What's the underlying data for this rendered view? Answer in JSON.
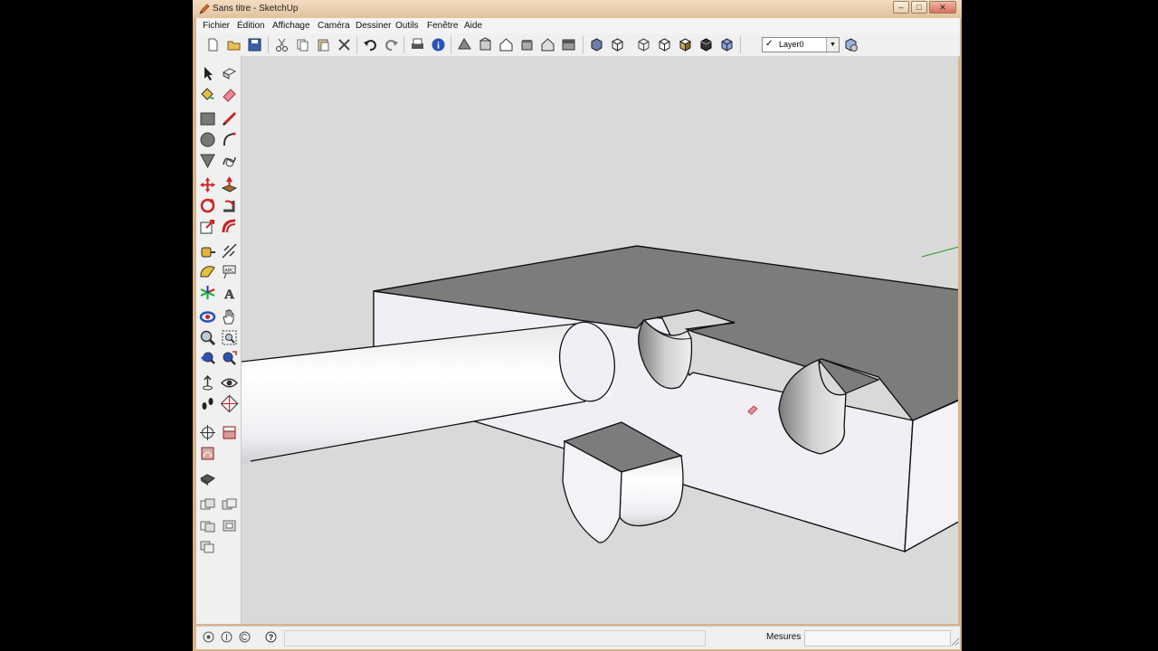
{
  "window": {
    "title": "Sans titre - SketchUp"
  },
  "menu": [
    "Fichier",
    "Édition",
    "Affichage",
    "Caméra",
    "Dessiner",
    "Outils",
    "Fenêtre",
    "Aide"
  ],
  "layer": {
    "name": "Layer0",
    "checked": true
  },
  "status": {
    "measure_label": "Mesures",
    "measure_value": ""
  },
  "colors": {
    "accent_red": "#cc2222",
    "axis_green": "#2a9a2a",
    "viewport_bg": "#d9d9d9",
    "face_top": "#7c7c7c",
    "face_side": "#f1eff5"
  }
}
